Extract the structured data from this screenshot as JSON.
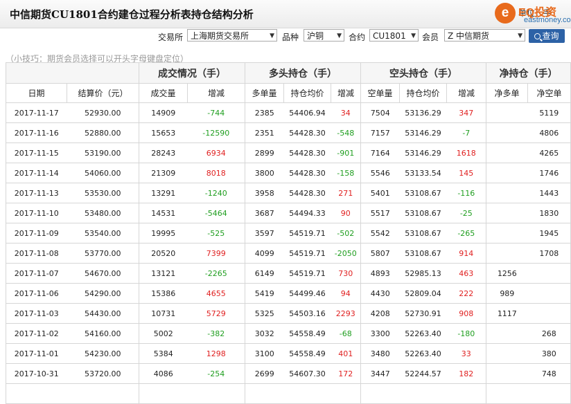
{
  "header": {
    "title": "中信期货CU1801合约建仓过程分析表持仓结构分析",
    "unit_label": "单位：手",
    "logo": {
      "mark": "e",
      "name": "EQ投资",
      "url": "eastmoney.com"
    }
  },
  "filters": {
    "exchange_label": "交易所",
    "exchange_value": "上海期货交易所",
    "variety_label": "品种",
    "variety_value": "沪铜",
    "contract_label": "合约",
    "contract_value": "CU1801",
    "member_label": "会员",
    "member_value": "Z 中信期货",
    "query_label": "查询"
  },
  "tip": "（小技巧：期货会员选择可以开头字母键盘定位）",
  "table": {
    "groups": [
      "成交情况（手）",
      "多头持仓（手）",
      "空头持仓（手）",
      "净持仓（手）"
    ],
    "columns": [
      "日期",
      "结算价（元）",
      "成交量",
      "增减",
      "多单量",
      "持仓均价",
      "增减",
      "空单量",
      "持仓均价",
      "增减",
      "净多单",
      "净空单"
    ],
    "rows": [
      [
        "2017-11-17",
        "52930.00",
        "14909",
        "-744",
        "2385",
        "54406.94",
        "34",
        "7504",
        "53136.29",
        "347",
        "",
        "5119"
      ],
      [
        "2017-11-16",
        "52880.00",
        "15653",
        "-12590",
        "2351",
        "54428.30",
        "-548",
        "7157",
        "53146.29",
        "-7",
        "",
        "4806"
      ],
      [
        "2017-11-15",
        "53190.00",
        "28243",
        "6934",
        "2899",
        "54428.30",
        "-901",
        "7164",
        "53146.29",
        "1618",
        "",
        "4265"
      ],
      [
        "2017-11-14",
        "54060.00",
        "21309",
        "8018",
        "3800",
        "54428.30",
        "-158",
        "5546",
        "53133.54",
        "145",
        "",
        "1746"
      ],
      [
        "2017-11-13",
        "53530.00",
        "13291",
        "-1240",
        "3958",
        "54428.30",
        "271",
        "5401",
        "53108.67",
        "-116",
        "",
        "1443"
      ],
      [
        "2017-11-10",
        "53480.00",
        "14531",
        "-5464",
        "3687",
        "54494.33",
        "90",
        "5517",
        "53108.67",
        "-25",
        "",
        "1830"
      ],
      [
        "2017-11-09",
        "53540.00",
        "19995",
        "-525",
        "3597",
        "54519.71",
        "-502",
        "5542",
        "53108.67",
        "-265",
        "",
        "1945"
      ],
      [
        "2017-11-08",
        "53770.00",
        "20520",
        "7399",
        "4099",
        "54519.71",
        "-2050",
        "5807",
        "53108.67",
        "914",
        "",
        "1708"
      ],
      [
        "2017-11-07",
        "54670.00",
        "13121",
        "-2265",
        "6149",
        "54519.71",
        "730",
        "4893",
        "52985.13",
        "463",
        "1256",
        ""
      ],
      [
        "2017-11-06",
        "54290.00",
        "15386",
        "4655",
        "5419",
        "54499.46",
        "94",
        "4430",
        "52809.04",
        "222",
        "989",
        ""
      ],
      [
        "2017-11-03",
        "54430.00",
        "10731",
        "5729",
        "5325",
        "54503.16",
        "2293",
        "4208",
        "52730.91",
        "908",
        "1117",
        ""
      ],
      [
        "2017-11-02",
        "54160.00",
        "5002",
        "-382",
        "3032",
        "54558.49",
        "-68",
        "3300",
        "52263.40",
        "-180",
        "",
        "268"
      ],
      [
        "2017-11-01",
        "54230.00",
        "5384",
        "1298",
        "3100",
        "54558.49",
        "401",
        "3480",
        "52263.40",
        "33",
        "",
        "380"
      ],
      [
        "2017-10-31",
        "53720.00",
        "4086",
        "-254",
        "2699",
        "54607.30",
        "172",
        "3447",
        "52244.57",
        "182",
        "",
        "748"
      ],
      [
        "",
        "",
        "",
        "",
        "",
        "",
        "",
        "",
        "",
        "",
        "",
        ""
      ]
    ]
  },
  "colors": {
    "up": "#e02020",
    "down": "#1f9e1f",
    "button": "#2d62a6",
    "logo": "#e86a1c"
  }
}
